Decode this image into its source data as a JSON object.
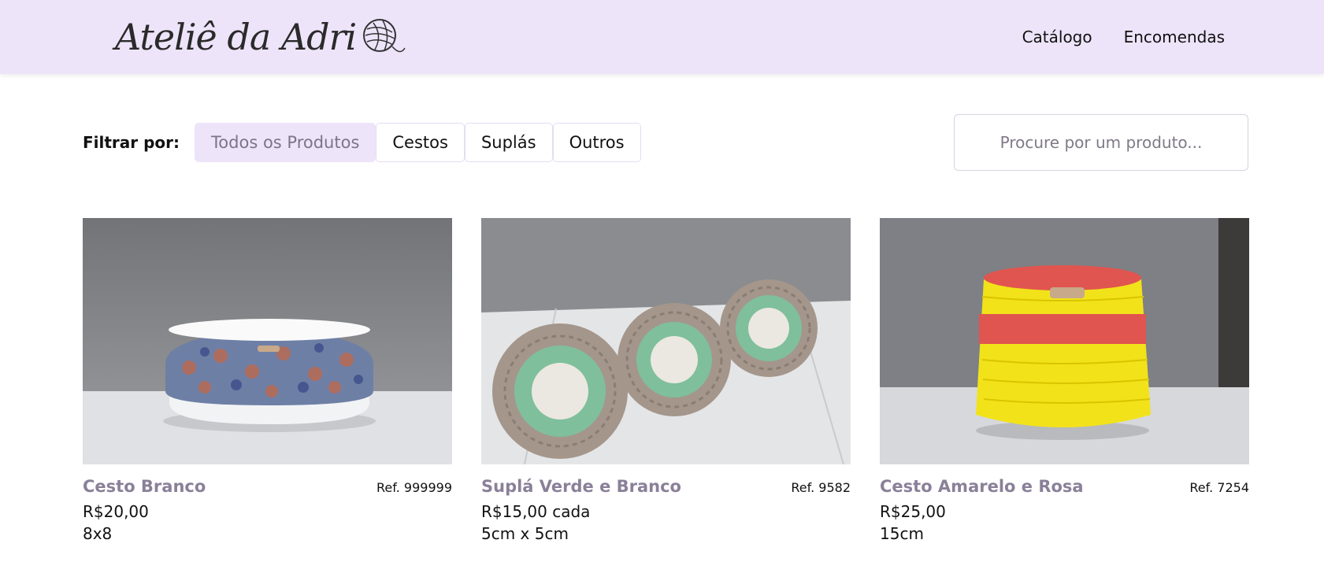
{
  "brand": {
    "logo_text": "Ateliê da Adri",
    "logo_icon": "yarn-ball-icon"
  },
  "nav": {
    "items": [
      "Catálogo",
      "Encomendas"
    ]
  },
  "filters": {
    "label": "Filtrar por:",
    "options": [
      "Todos os Produtos",
      "Cestos",
      "Suplás",
      "Outros"
    ],
    "active": "Todos os Produtos"
  },
  "search": {
    "placeholder": "Procure por um produto..."
  },
  "products": [
    {
      "name": "Cesto Branco",
      "ref": "Ref. 999999",
      "price": "R$20,00",
      "size": "8x8",
      "image": "white-basket-photo"
    },
    {
      "name": "Suplá Verde e Branco",
      "ref": "Ref. 9582",
      "price": "R$15,00 cada",
      "size": "5cm x 5cm",
      "image": "green-doilies-photo"
    },
    {
      "name": "Cesto Amarelo e Rosa",
      "ref": "Ref. 7254",
      "price": "R$25,00",
      "size": "15cm",
      "image": "yellow-basket-photo"
    }
  ],
  "colors": {
    "header_bg": "#eee4fa",
    "product_name": "#8a8098",
    "active_chip_text": "#7d7487"
  }
}
